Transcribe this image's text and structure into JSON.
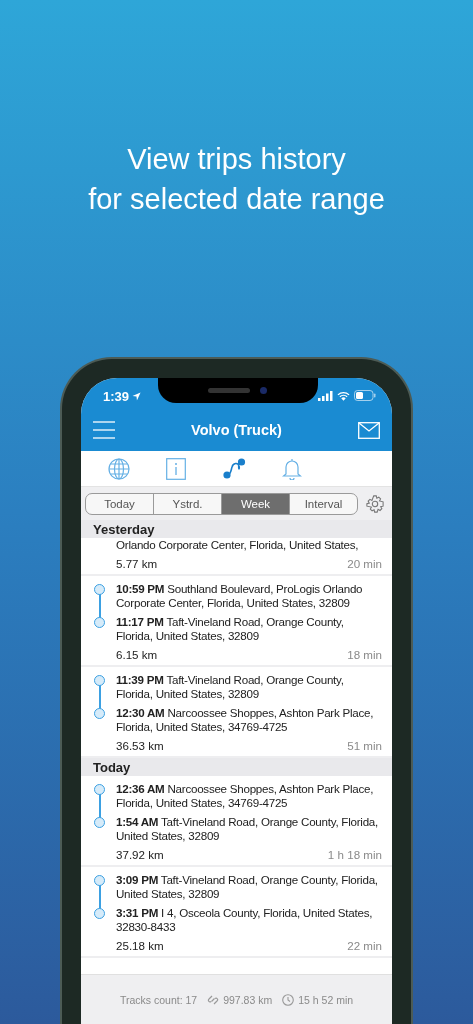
{
  "headline_lines": [
    "View trips history",
    "for selected date range"
  ],
  "status_bar": {
    "time": "1:39"
  },
  "nav": {
    "title": "Volvo (Truck)"
  },
  "icon_tabs": [
    {
      "kind": "globe",
      "selected": false
    },
    {
      "kind": "info",
      "selected": false
    },
    {
      "kind": "route",
      "selected": true
    },
    {
      "kind": "bell",
      "selected": false
    }
  ],
  "periods": [
    {
      "label": "Today",
      "selected": false
    },
    {
      "label": "Ystrd.",
      "selected": false
    },
    {
      "label": "Week",
      "selected": true
    },
    {
      "label": "Interval",
      "selected": false
    }
  ],
  "sections": [
    {
      "title": "Yesterday",
      "trips": [
        {
          "kind": "partial",
          "stops": [
            "Orlando Corporate Center, Florida, United States,"
          ],
          "distance": "5.77 km",
          "duration": "20 min"
        },
        {
          "kind": "full",
          "stops": [
            "**10:59 PM** Southland Boulevard, ProLogis Orlando Corporate Center, Florida, United States, 32809",
            "**11:17 PM** Taft-Vineland Road, Orange County, Florida, United States, 32809"
          ],
          "distance": "6.15 km",
          "duration": "18 min"
        },
        {
          "kind": "full",
          "stops": [
            "**11:39 PM** Taft-Vineland Road, Orange County, Florida, United States, 32809",
            "**12:30 AM** Narcoossee Shoppes, Ashton Park Place, Florida, United States, 34769-4725"
          ],
          "distance": "36.53 km",
          "duration": "51 min"
        }
      ]
    },
    {
      "title": "Today",
      "trips": [
        {
          "kind": "full",
          "stops": [
            "**12:36 AM** Narcoossee Shoppes, Ashton Park Place, Florida, United States, 34769-4725",
            "**1:54 AM** Taft-Vineland Road, Orange County, Florida, United States, 32809"
          ],
          "distance": "37.92 km",
          "duration": "1 h 18 min"
        },
        {
          "kind": "full",
          "stops": [
            "**3:09 PM** Taft-Vineland Road, Orange County, Florida, United States, 32809",
            "**3:31 PM** I 4, Osceola County, Florida, United States, 32830-8433"
          ],
          "distance": "25.18 km",
          "duration": "22 min"
        }
      ]
    }
  ],
  "footer": {
    "tracks_count": "Tracks count: 17",
    "distance": "997.83 km",
    "duration": "15 h 52 min"
  }
}
